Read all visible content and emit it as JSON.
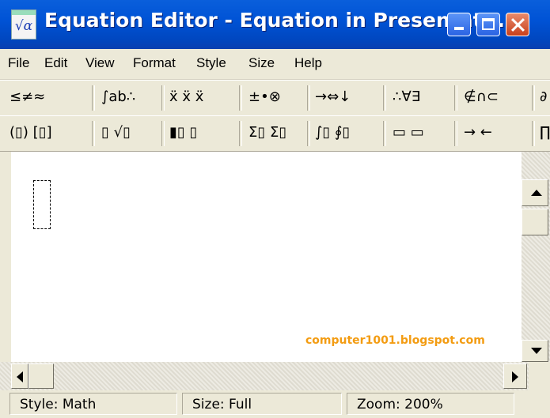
{
  "window": {
    "title": "Equation Editor - Equation in Presentat...",
    "icon_text": "√α"
  },
  "menu": [
    "File",
    "Edit",
    "View",
    "Format",
    "Style",
    "Size",
    "Help"
  ],
  "toolbar_row1": [
    {
      "name": "relational-symbols",
      "glyphs": "≤≠≈"
    },
    {
      "name": "spaces-and-ellipses",
      "glyphs": "∫ab∴"
    },
    {
      "name": "embellishments",
      "glyphs": "ẍ ẍ ẍ"
    },
    {
      "name": "operator-symbols",
      "glyphs": "±•⊗"
    },
    {
      "name": "arrow-symbols",
      "glyphs": "→⇔↓"
    },
    {
      "name": "logical-symbols",
      "glyphs": "∴∀∃"
    },
    {
      "name": "set-theory-symbols",
      "glyphs": "∉∩⊂"
    },
    {
      "name": "misc-symbols",
      "glyphs": "∂"
    }
  ],
  "toolbar_row2": [
    {
      "name": "fence-templates",
      "glyphs": "(▯) [▯]"
    },
    {
      "name": "fraction-radical-templates",
      "glyphs": "▯ √▯"
    },
    {
      "name": "subscript-superscript-templates",
      "glyphs": "▮▯ ▯"
    },
    {
      "name": "summation-templates",
      "glyphs": "Σ▯ Σ▯"
    },
    {
      "name": "integral-templates",
      "glyphs": "∫▯ ∮▯"
    },
    {
      "name": "underbar-overbar-templates",
      "glyphs": "▭ ▭"
    },
    {
      "name": "labeled-arrow-templates",
      "glyphs": "→ ←"
    },
    {
      "name": "product-templates",
      "glyphs": "∏"
    }
  ],
  "editor": {
    "watermark": "computer1001.blogspot.com"
  },
  "status": {
    "style": "Style: Math",
    "size": "Size: Full",
    "zoom": "Zoom: 200%"
  }
}
